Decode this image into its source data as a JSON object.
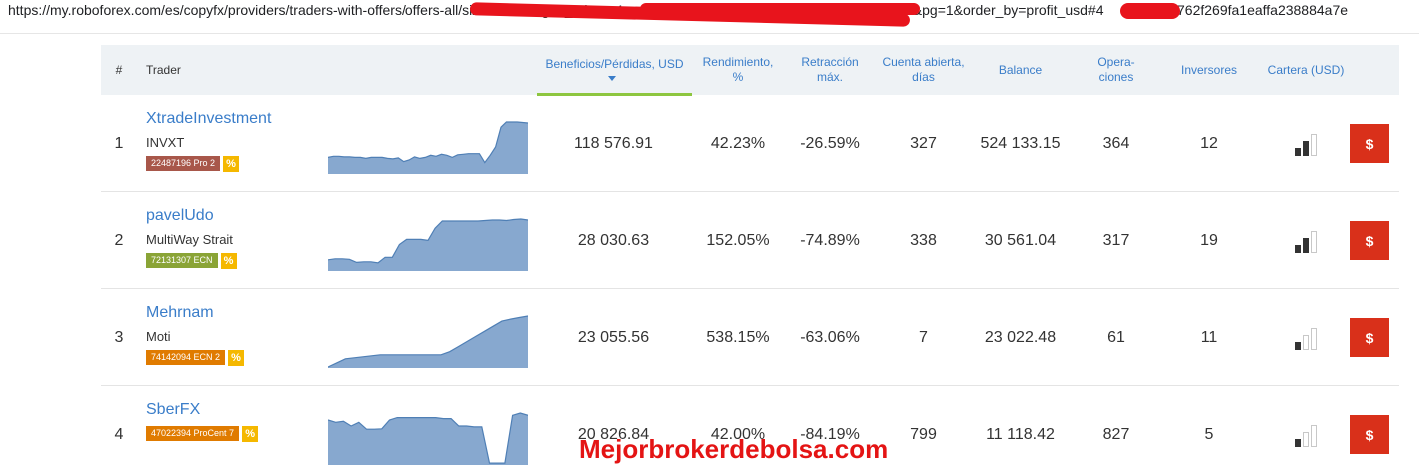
{
  "browser": {
    "url_start": "https://my.roboforex.com/es/copyfx/providers/traders-with-offers/",
    "url_mid": "offers-all/six-months/?grid_token=4",
    "url_tail1": "e&pg=1&order_by=profit_usd#4",
    "url_tail2": "762f269fa1eaffa238884a7e"
  },
  "columns": {
    "num": "#",
    "trader": "Trader",
    "profit": "Beneficios/Pérdidas, USD",
    "yield_1": "Rendimiento,",
    "yield_2": "%",
    "dd_1": "Retracción",
    "dd_2": "máx.",
    "days_1": "Cuenta abierta,",
    "days_2": "días",
    "balance": "Balance",
    "ops_1": "Opera-",
    "ops_2": "ciones",
    "investors": "Inversores",
    "portfolio": "Cartera (USD)"
  },
  "colors": {
    "link": "#3a7dc9",
    "sort_underline": "#8dc63f",
    "invest_button": "#d9301a",
    "chart_fill": "#87a8cf",
    "chart_line": "#4f7fb5",
    "percent_badge": "#f5b800"
  },
  "rows": [
    {
      "index": "1",
      "name": "XtradeInvestment",
      "strategy": "INVXT",
      "account": "22487196 Pro 2",
      "account_color": "#a8574a",
      "pct": "%",
      "profit": "118 576.91",
      "yield": "42.23%",
      "drawdown": "-26.59%",
      "days": "327",
      "balance": "524 133.15",
      "operations": "364",
      "investors": "12",
      "portfolio_level": 2,
      "button": "$",
      "trend": [
        0.3,
        0.32,
        0.32,
        0.31,
        0.31,
        0.3,
        0.3,
        0.28,
        0.3,
        0.3,
        0.3,
        0.28,
        0.27,
        0.29,
        0.22,
        0.25,
        0.31,
        0.28,
        0.3,
        0.34,
        0.32,
        0.36,
        0.34,
        0.3,
        0.35,
        0.36,
        0.37,
        0.37,
        0.37,
        0.2,
        0.34,
        0.5,
        0.88,
        0.98,
        0.98,
        0.98,
        0.97,
        0.96
      ]
    },
    {
      "index": "2",
      "name": "pavelUdo",
      "strategy": "MultiWay Strait",
      "account": "72131307 ECN",
      "account_color": "#8aa436",
      "pct": "%",
      "profit": "28 030.63",
      "yield": "152.05%",
      "drawdown": "-74.89%",
      "days": "338",
      "balance": "30 561.04",
      "operations": "317",
      "investors": "19",
      "portfolio_level": 2,
      "button": "$",
      "trend": [
        0.2,
        0.22,
        0.22,
        0.21,
        0.15,
        0.16,
        0.16,
        0.14,
        0.25,
        0.25,
        0.5,
        0.6,
        0.6,
        0.6,
        0.58,
        0.82,
        0.96,
        0.96,
        0.96,
        0.96,
        0.96,
        0.96,
        0.97,
        0.98,
        0.98,
        0.97,
        0.99,
        1.0,
        0.98
      ]
    },
    {
      "index": "3",
      "name": "Mehrnam",
      "strategy": "Moti",
      "account": "74142094 ECN 2",
      "account_color": "#e07b00",
      "pct": "%",
      "profit": "23 055.56",
      "yield": "538.15%",
      "drawdown": "-63.06%",
      "days": "7",
      "balance": "23 022.48",
      "operations": "61",
      "investors": "11",
      "portfolio_level": 1,
      "button": "$",
      "trend": [
        0.0,
        0.08,
        0.16,
        0.18,
        0.2,
        0.22,
        0.24,
        0.24,
        0.24,
        0.24,
        0.24,
        0.24,
        0.24,
        0.24,
        0.3,
        0.4,
        0.5,
        0.6,
        0.7,
        0.8,
        0.9,
        0.94,
        0.97,
        1.0
      ]
    },
    {
      "index": "4",
      "name": "SberFX",
      "strategy": "",
      "account": "47022394 ProCent 7",
      "account_color": "#e07b00",
      "pct": "%",
      "profit": "20 826.84",
      "yield": "42.00%",
      "drawdown": "-84.19%",
      "days": "799",
      "balance": "11 118.42",
      "operations": "827",
      "investors": "5",
      "portfolio_level": 1,
      "button": "$",
      "trend": [
        0.95,
        0.9,
        0.92,
        0.82,
        0.9,
        0.75,
        0.75,
        0.76,
        0.95,
        1.0,
        1.0,
        1.0,
        1.0,
        1.0,
        1.0,
        0.98,
        0.98,
        0.82,
        0.82,
        0.8,
        0.8,
        0.02,
        0.02,
        0.02,
        1.05,
        1.1,
        1.05
      ]
    }
  ],
  "watermark": "Mejorbrokerdebolsa.com"
}
